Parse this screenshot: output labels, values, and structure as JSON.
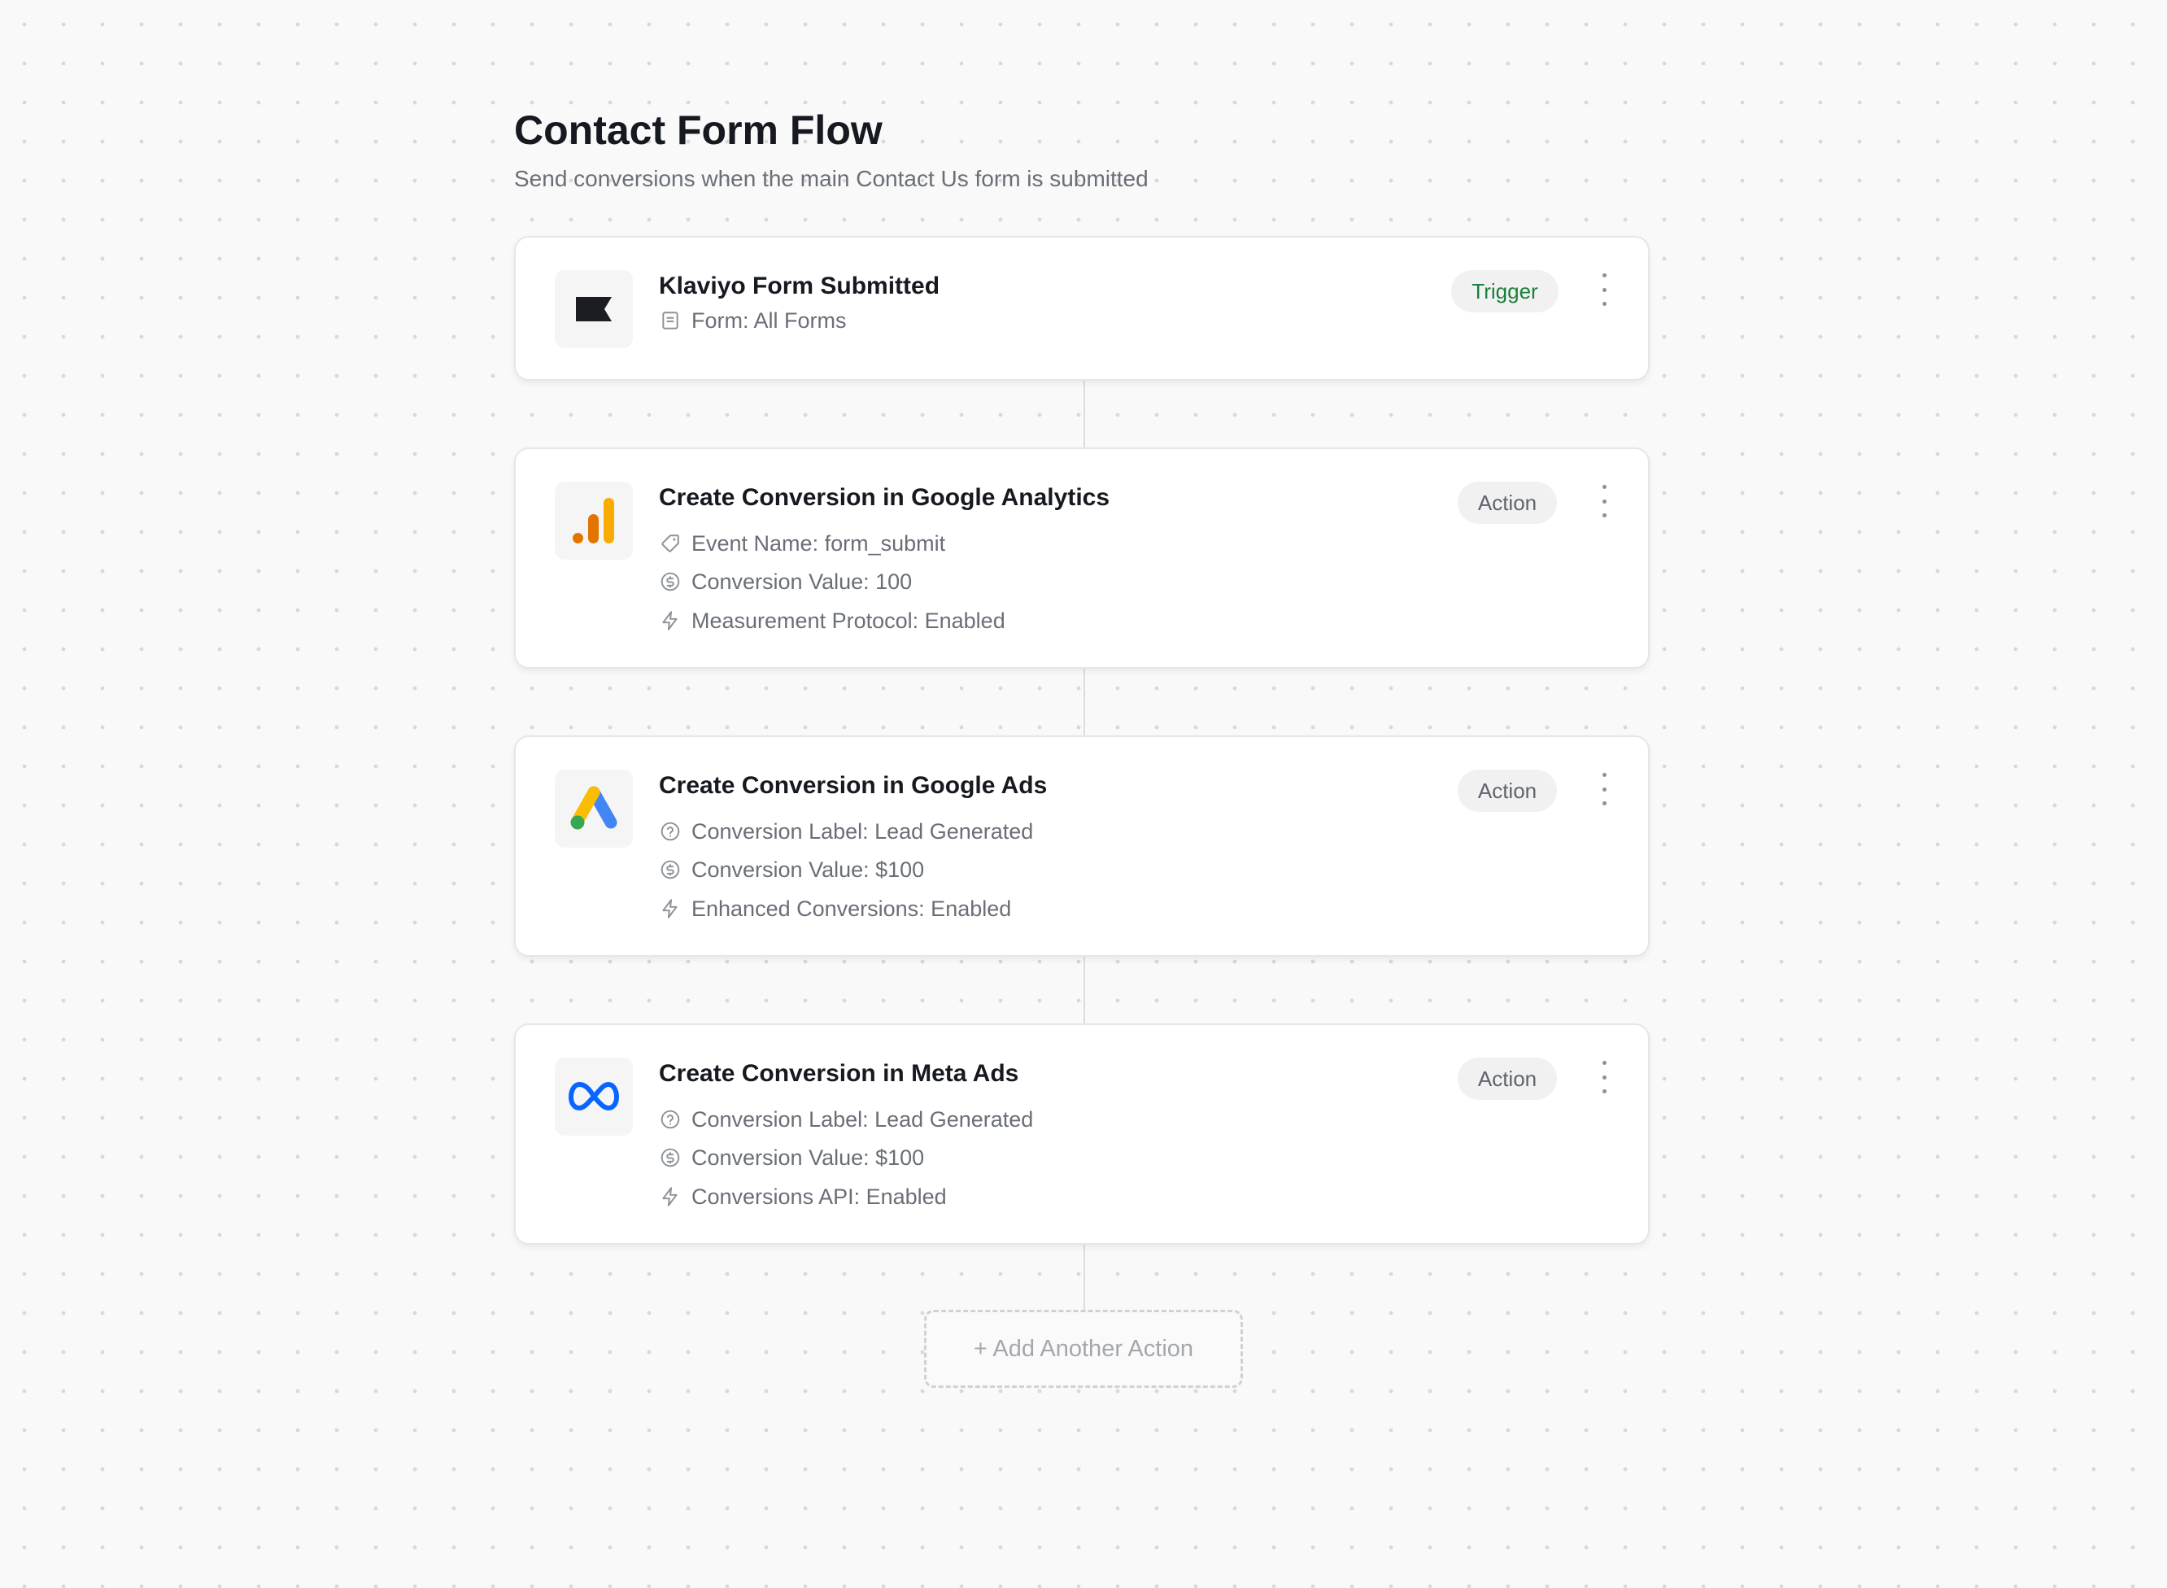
{
  "header": {
    "title": "Contact Form Flow",
    "subtitle": "Send conversions when the main Contact Us form is submitted"
  },
  "steps": [
    {
      "title": "Klaviyo Form Submitted",
      "badge": "Trigger",
      "icon": "klaviyo-logo",
      "details": [
        {
          "icon": "form-icon",
          "text": "Form: All Forms"
        }
      ]
    },
    {
      "title": "Create Conversion in Google Analytics",
      "badge": "Action",
      "icon": "google-analytics-logo",
      "details": [
        {
          "icon": "tag-icon",
          "text": "Event Name: form_submit"
        },
        {
          "icon": "dollar-icon",
          "text": "Conversion Value: 100"
        },
        {
          "icon": "bolt-icon",
          "text": "Measurement Protocol: Enabled"
        }
      ]
    },
    {
      "title": "Create Conversion in Google Ads",
      "badge": "Action",
      "icon": "google-ads-logo",
      "details": [
        {
          "icon": "question-icon",
          "text": "Conversion Label: Lead Generated"
        },
        {
          "icon": "dollar-icon",
          "text": "Conversion Value: $100"
        },
        {
          "icon": "bolt-icon",
          "text": "Enhanced Conversions: Enabled"
        }
      ]
    },
    {
      "title": "Create Conversion in Meta Ads",
      "badge": "Action",
      "icon": "meta-logo",
      "details": [
        {
          "icon": "question-icon",
          "text": "Conversion Label: Lead Generated"
        },
        {
          "icon": "dollar-icon",
          "text": "Conversion Value: $100"
        },
        {
          "icon": "bolt-icon",
          "text": "Conversions API: Enabled"
        }
      ]
    }
  ],
  "add_action": {
    "label": "+ Add Another Action"
  },
  "colors": {
    "trigger_text": "#1a7f3c",
    "badge_bg": "#f1f1f2",
    "muted_text": "#6a6e77",
    "ga_orange": "#e37400",
    "ga_yellow": "#f9ab00",
    "ads_blue": "#4285f4",
    "ads_yellow": "#fbbc04",
    "ads_green": "#34a853",
    "meta_blue": "#0866ff"
  }
}
